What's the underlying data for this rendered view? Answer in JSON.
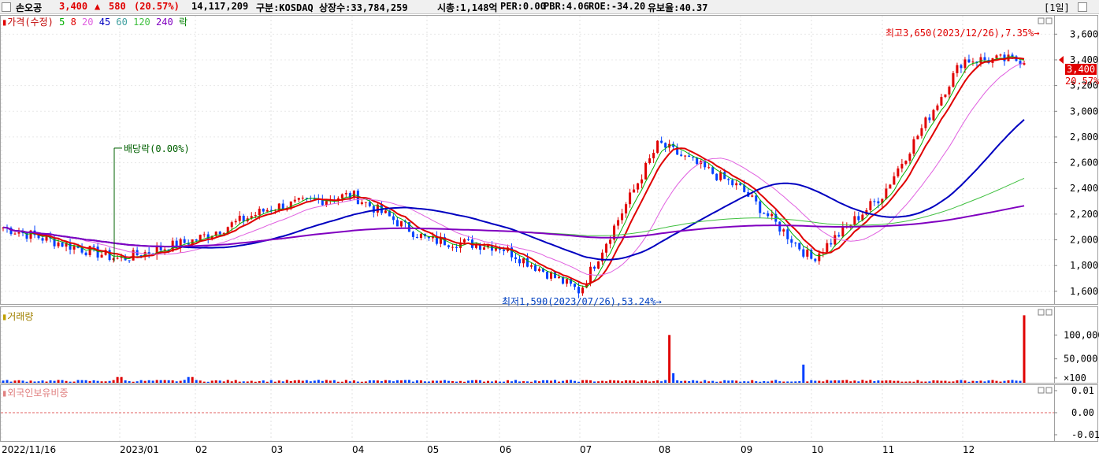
{
  "header": {
    "name": "손오공",
    "price": "3,400",
    "change_icon": "▲",
    "change": "580",
    "change_pct": "(20.57%)",
    "volume": "14,117,209",
    "market": "구분:KOSDAQ",
    "shares": "상장수:33,784,259",
    "mcap": "시총:1,148억",
    "per": "PER:0.00",
    "pbr": "PBR:4.06",
    "roe": "ROE:-34.20",
    "float": "유보율:40.37",
    "period": "[1일]",
    "colors": {
      "up": "#e00000",
      "down": "#0040ff"
    }
  },
  "price_panel": {
    "legend": {
      "title": "가격(수정)",
      "ma": [
        {
          "label": "5",
          "color": "#00b000"
        },
        {
          "label": "8",
          "color": "#e00000"
        },
        {
          "label": "20",
          "color": "#e060e0"
        },
        {
          "label": "45",
          "color": "#0000c0"
        },
        {
          "label": "60",
          "color": "#40a0a0"
        },
        {
          "label": "120",
          "color": "#40c040"
        },
        {
          "label": "240",
          "color": "#8000c0"
        }
      ],
      "rak": "락"
    },
    "high_note": "최고3,650(2023/12/26),7.35%→",
    "low_note": "최저1,590(2023/07/26),53.24%→",
    "dividend_note": "배당락(0.00%)",
    "price_tag": "3,400",
    "pct_tag": "20.57%"
  },
  "volume_panel": {
    "title": "거래량"
  },
  "foreign_panel": {
    "title": "외국인보유비중"
  },
  "chart_data": [
    {
      "type": "candlestick",
      "title": "가격(수정)",
      "y_ticks": [
        "1,600",
        "1,800",
        "2,000",
        "2,200",
        "2,400",
        "2,600",
        "2,800",
        "3,000",
        "3,200",
        "3,400",
        "3,600"
      ],
      "ylim": [
        1550,
        3700
      ],
      "x_ticks": [
        "2022/11/16",
        "2023/01",
        "02",
        "03",
        "04",
        "05",
        "06",
        "07",
        "08",
        "09",
        "10",
        "11",
        "12"
      ],
      "key_points": [
        {
          "month": "2022/11",
          "approx_close": 2100
        },
        {
          "month": "2023/01",
          "approx_close": 1850
        },
        {
          "month": "02",
          "approx_close": 2000
        },
        {
          "month": "03",
          "approx_close": 2250
        },
        {
          "month": "04",
          "approx_close": 2350
        },
        {
          "month": "05",
          "approx_close": 2000
        },
        {
          "month": "06",
          "approx_close": 1950
        },
        {
          "month": "07",
          "approx_close": 1600
        },
        {
          "month": "08",
          "approx_close": 2750
        },
        {
          "month": "09",
          "approx_close": 2400
        },
        {
          "month": "10",
          "approx_close": 1850
        },
        {
          "month": "11",
          "approx_close": 2350
        },
        {
          "month": "12",
          "approx_close": 3400
        }
      ],
      "high": 3650,
      "low": 1590
    },
    {
      "type": "bar",
      "title": "거래량",
      "y_ticks": [
        "100,000",
        "50,000",
        "×100"
      ],
      "peaks": [
        {
          "month": "08",
          "value": 100000
        },
        {
          "month": "10",
          "value": 38000
        },
        {
          "month": "12",
          "value": 141171
        }
      ]
    },
    {
      "type": "line",
      "title": "외국인보유비중",
      "y_ticks": [
        "0.01",
        "0.00",
        "-0.01"
      ],
      "value": 0.0
    }
  ]
}
